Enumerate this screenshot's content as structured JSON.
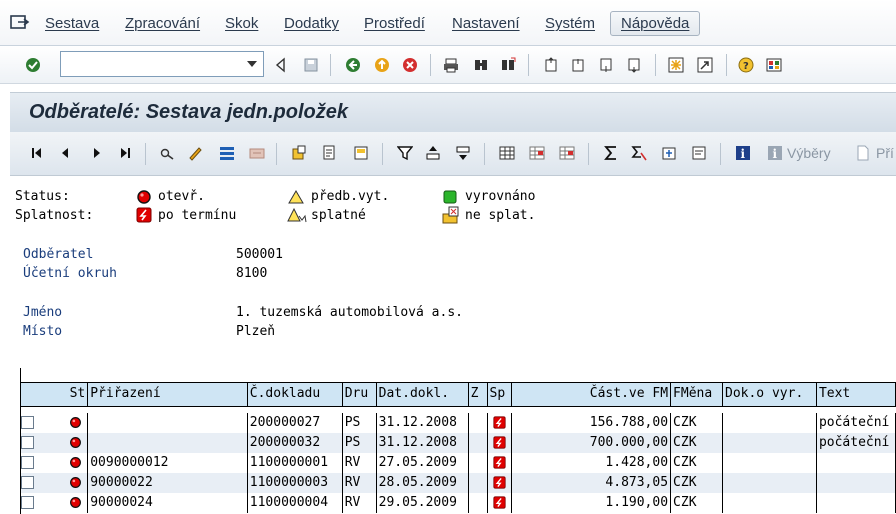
{
  "menu": [
    "Sestava",
    "Zpracování",
    "Skok",
    "Dodatky",
    "Prostředí",
    "Nastavení",
    "Systém",
    "Nápověda"
  ],
  "title": "Odběratelé: Sestava jedn.položek",
  "toolbar": {
    "selections_label": "Výběry",
    "print_label": "Pří"
  },
  "legend": {
    "status_label": "Status:",
    "due_label": "Splatnost:",
    "open": "otevř.",
    "parked": "předb.vyt.",
    "cleared": "vyrovnáno",
    "overdue": "po termínu",
    "due": "splatné",
    "not_due": "ne splat."
  },
  "header": {
    "customer_label": "Odběratel",
    "customer_value": "500001",
    "company_label": "Účetní okruh",
    "company_value": "8100",
    "name_label": "Jméno",
    "name_value": "1. tuzemská automobilová a.s.",
    "city_label": "Místo",
    "city_value": "Plzeň"
  },
  "columns": [
    "St",
    "Přiřazení",
    "Č.dokladu",
    "Dru",
    "Dat.dokl.",
    "Z",
    "Sp",
    "Část.ve FM",
    "FMěna",
    "Dok.o vyr.",
    "Text"
  ],
  "rows": [
    {
      "assign": "",
      "doc": "200000027",
      "type": "PS",
      "date": "31.12.2008",
      "amount": "156.788,00",
      "cur": "CZK",
      "text": "počáteční"
    },
    {
      "assign": "",
      "doc": "200000032",
      "type": "PS",
      "date": "31.12.2008",
      "amount": "700.000,00",
      "cur": "CZK",
      "text": "počáteční"
    },
    {
      "assign": "0090000012",
      "doc": "1100000001",
      "type": "RV",
      "date": "27.05.2009",
      "amount": "1.428,00",
      "cur": "CZK",
      "text": ""
    },
    {
      "assign": "90000022",
      "doc": "1100000003",
      "type": "RV",
      "date": "28.05.2009",
      "amount": "4.873,05",
      "cur": "CZK",
      "text": ""
    },
    {
      "assign": "90000024",
      "doc": "1100000004",
      "type": "RV",
      "date": "29.05.2009",
      "amount": "1.190,00",
      "cur": "CZK",
      "text": ""
    }
  ],
  "colors": {
    "accent": "#1a3d7c",
    "header_bg": "#cfe5f4",
    "status_red": "#e00000"
  }
}
